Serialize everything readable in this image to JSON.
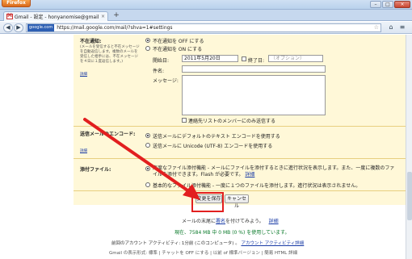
{
  "browser": {
    "app_button": "Firefox",
    "window_controls": [
      "–",
      "□",
      "×"
    ],
    "tab_title": "Gmail - 設定 - honyanomise@gmail.com",
    "tab_close": "×",
    "new_tab": "+",
    "site_identity": "google.com",
    "url": "https://mail.google.com/mail/?shva=1#settings",
    "nav_back": "◀",
    "nav_forward": "▶"
  },
  "vacation": {
    "label": "不在通知:",
    "description": "(メールを受信すると不在メッセージを自動返信します。複数のメールを受信した相手には、不在メッセージを４日に１度返信します。)",
    "detail_link": "詳細",
    "off_option": "不在通知を OFF にする",
    "on_option": "不在通知を ON にする",
    "start_label": "開始日:",
    "start_value": "2011年5月20日",
    "end_label": "終了日:",
    "end_placeholder": "（オプション）",
    "subject_label": "件名:",
    "message_label": "メッセージ:",
    "contacts_only": "連絡先リストのメンバーにのみ送信する"
  },
  "encoding": {
    "label": "送信メールのエンコード:",
    "detail_link": "詳細",
    "option_default": "送信メールにデフォルトのテキスト エンコードを使用する",
    "option_utf8": "送信メールに Unicode (UTF-8) エンコードを使用する"
  },
  "attachments": {
    "label": "添付ファイル:",
    "option_advanced": "高度なファイル添付機能 - メールにファイルを添付するときに進行状況を表示します。また、一度に複数のファイルを添付できます。Flash が必要です。",
    "option_advanced_link": "詳細",
    "option_basic": "基本的なファイル添付機能 - 一度に１つのファイルを添付します。進行状況は表示されません。"
  },
  "actions": {
    "save": "変更を保存",
    "cancel": "キャンセル"
  },
  "footer": {
    "tip_prefix": "メールの末尾に",
    "tip_link": "署名",
    "tip_suffix": "を付けてみよう。",
    "tip_more": "詳細",
    "usage": "現在、7584 MB 中 0 MB (0 %) を使用しています。",
    "activity_prefix": "前回のアカウント アクティビティ: 1分前 (このコンピュータ) 。",
    "activity_link": "アカウント アクティビティ詳細",
    "view_line": "Gmail の表示形式: 標準 | チャットを OFF にする | 以前 of 標準バージョン | 簡易 HTML 詳細"
  },
  "colors": {
    "settings_bg": "#fff8d8",
    "highlight": "#e21f1f",
    "arrow": "#e21f1f",
    "link": "#1a3ca6",
    "usage_green": "#0a7a2a"
  }
}
